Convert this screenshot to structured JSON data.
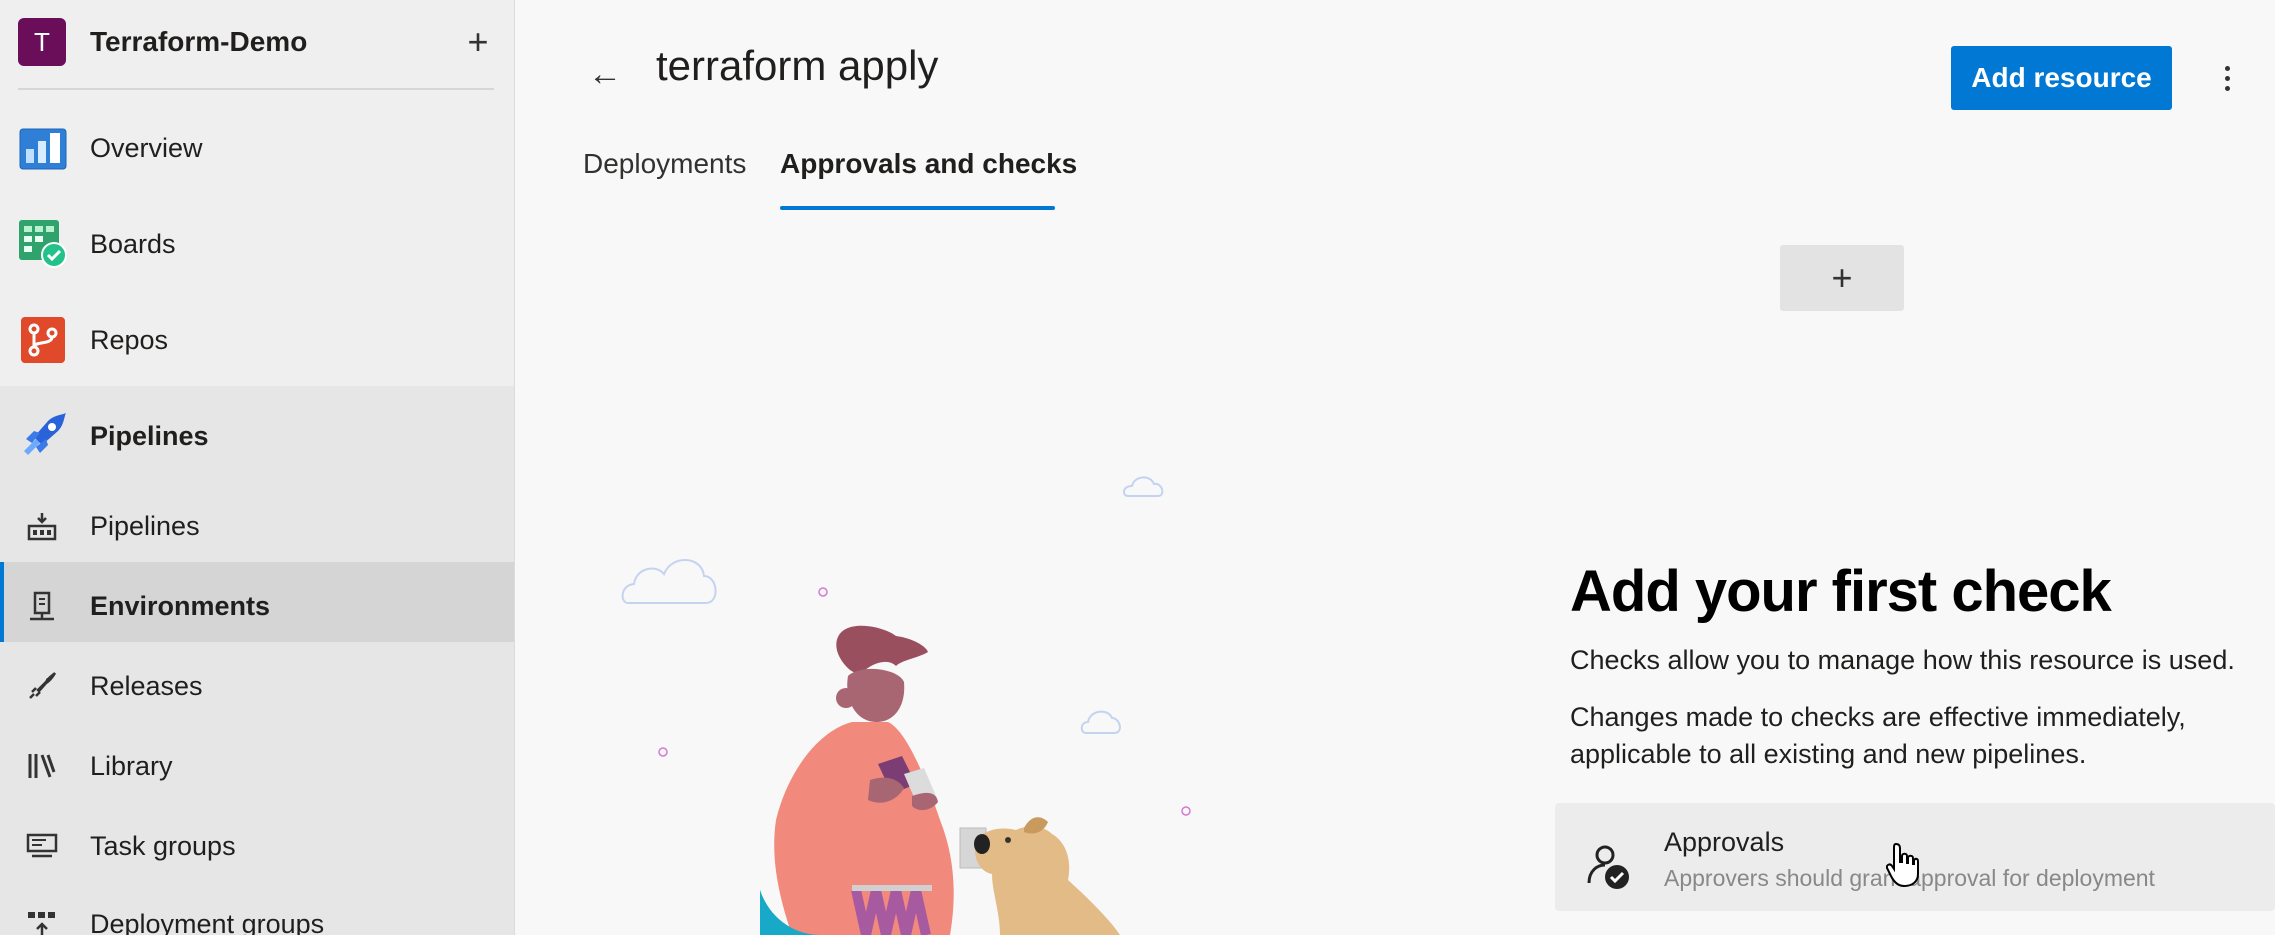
{
  "project": {
    "avatar_letter": "T",
    "name": "Terraform-Demo",
    "add_symbol": "+"
  },
  "sidebar": {
    "items": [
      {
        "label": "Overview",
        "icon": "overview-icon"
      },
      {
        "label": "Boards",
        "icon": "boards-icon"
      },
      {
        "label": "Repos",
        "icon": "repos-icon"
      },
      {
        "label": "Pipelines",
        "icon": "pipelines-service-icon"
      },
      {
        "label": "Pipelines",
        "icon": "pipelines-icon"
      },
      {
        "label": "Environments",
        "icon": "environments-icon",
        "selected": true
      },
      {
        "label": "Releases",
        "icon": "releases-icon"
      },
      {
        "label": "Library",
        "icon": "library-icon"
      },
      {
        "label": "Task groups",
        "icon": "task-groups-icon"
      },
      {
        "label": "Deployment groups",
        "icon": "deployment-groups-icon"
      }
    ]
  },
  "header": {
    "back_symbol": "←",
    "title": "terraform apply",
    "add_resource_label": "Add resource"
  },
  "tabs": [
    {
      "label": "Deployments",
      "active": false
    },
    {
      "label": "Approvals and checks",
      "active": true
    }
  ],
  "add_check_symbol": "+",
  "empty_state": {
    "heading": "Add your first check",
    "line1": "Checks allow you to manage how this resource is used.",
    "line2": "Changes made to checks are effective immediately, applicable to all existing and new pipelines."
  },
  "check_option": {
    "title": "Approvals",
    "description": "Approvers should grant approval for deployment",
    "icon": "approvals-icon"
  },
  "colors": {
    "accent": "#0078d4",
    "project_avatar": "#6b0e5a"
  }
}
